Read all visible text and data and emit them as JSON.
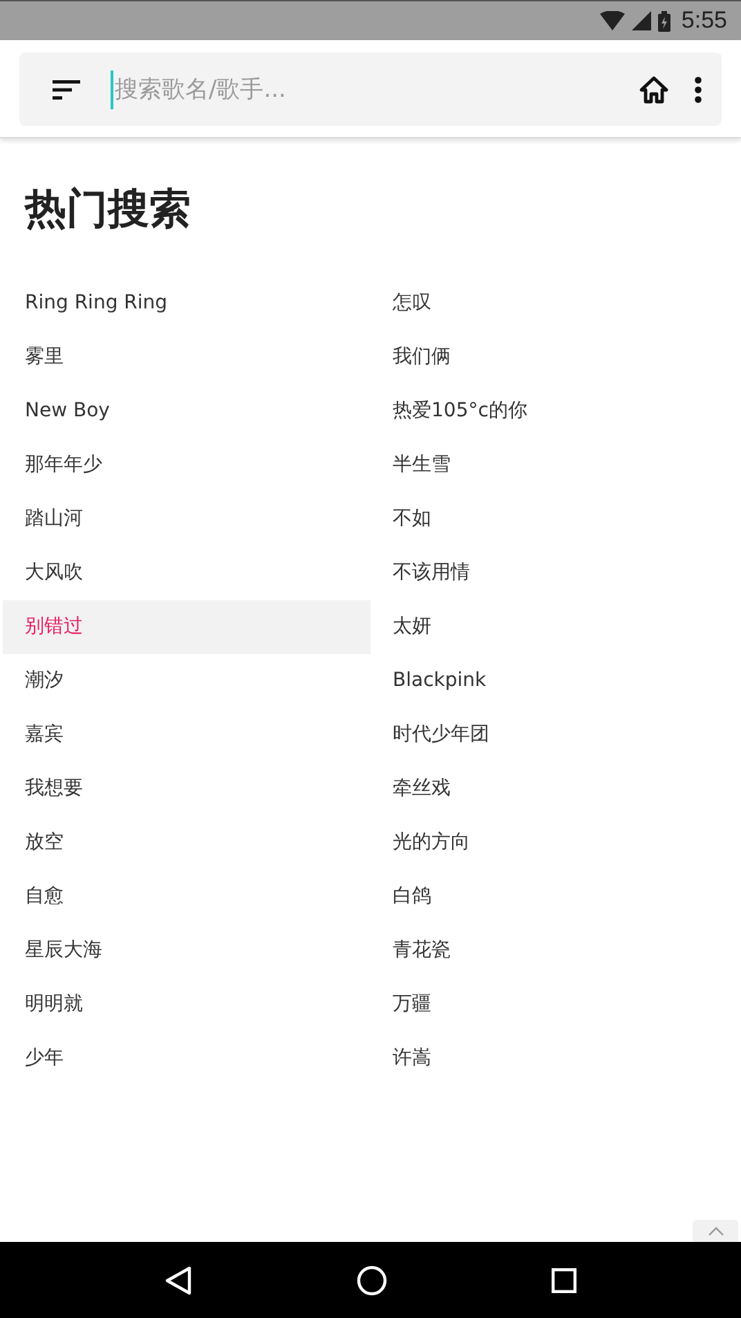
{
  "status_bar": {
    "time": "5:55"
  },
  "search": {
    "placeholder": "搜索歌名/歌手..."
  },
  "section_title": "热门搜索",
  "items": [
    {
      "label": "Ring Ring Ring",
      "selected": false
    },
    {
      "label": "怎叹",
      "selected": false
    },
    {
      "label": "雾里",
      "selected": false
    },
    {
      "label": "我们俩",
      "selected": false
    },
    {
      "label": "New Boy",
      "selected": false
    },
    {
      "label": "热爱105°c的你",
      "selected": false
    },
    {
      "label": "那年年少",
      "selected": false
    },
    {
      "label": "半生雪",
      "selected": false
    },
    {
      "label": "踏山河",
      "selected": false
    },
    {
      "label": "不如",
      "selected": false
    },
    {
      "label": "大风吹",
      "selected": false
    },
    {
      "label": "不该用情",
      "selected": false
    },
    {
      "label": "别错过",
      "selected": true
    },
    {
      "label": "太妍",
      "selected": false
    },
    {
      "label": "潮汐",
      "selected": false
    },
    {
      "label": "Blackpink",
      "selected": false
    },
    {
      "label": "嘉宾",
      "selected": false
    },
    {
      "label": "时代少年团",
      "selected": false
    },
    {
      "label": "我想要",
      "selected": false
    },
    {
      "label": "牵丝戏",
      "selected": false
    },
    {
      "label": "放空",
      "selected": false
    },
    {
      "label": "光的方向",
      "selected": false
    },
    {
      "label": "自愈",
      "selected": false
    },
    {
      "label": "白鸽",
      "selected": false
    },
    {
      "label": "星辰大海",
      "selected": false
    },
    {
      "label": "青花瓷",
      "selected": false
    },
    {
      "label": "明明就",
      "selected": false
    },
    {
      "label": "万疆",
      "selected": false
    },
    {
      "label": "少年",
      "selected": false
    },
    {
      "label": "许嵩",
      "selected": false
    }
  ]
}
